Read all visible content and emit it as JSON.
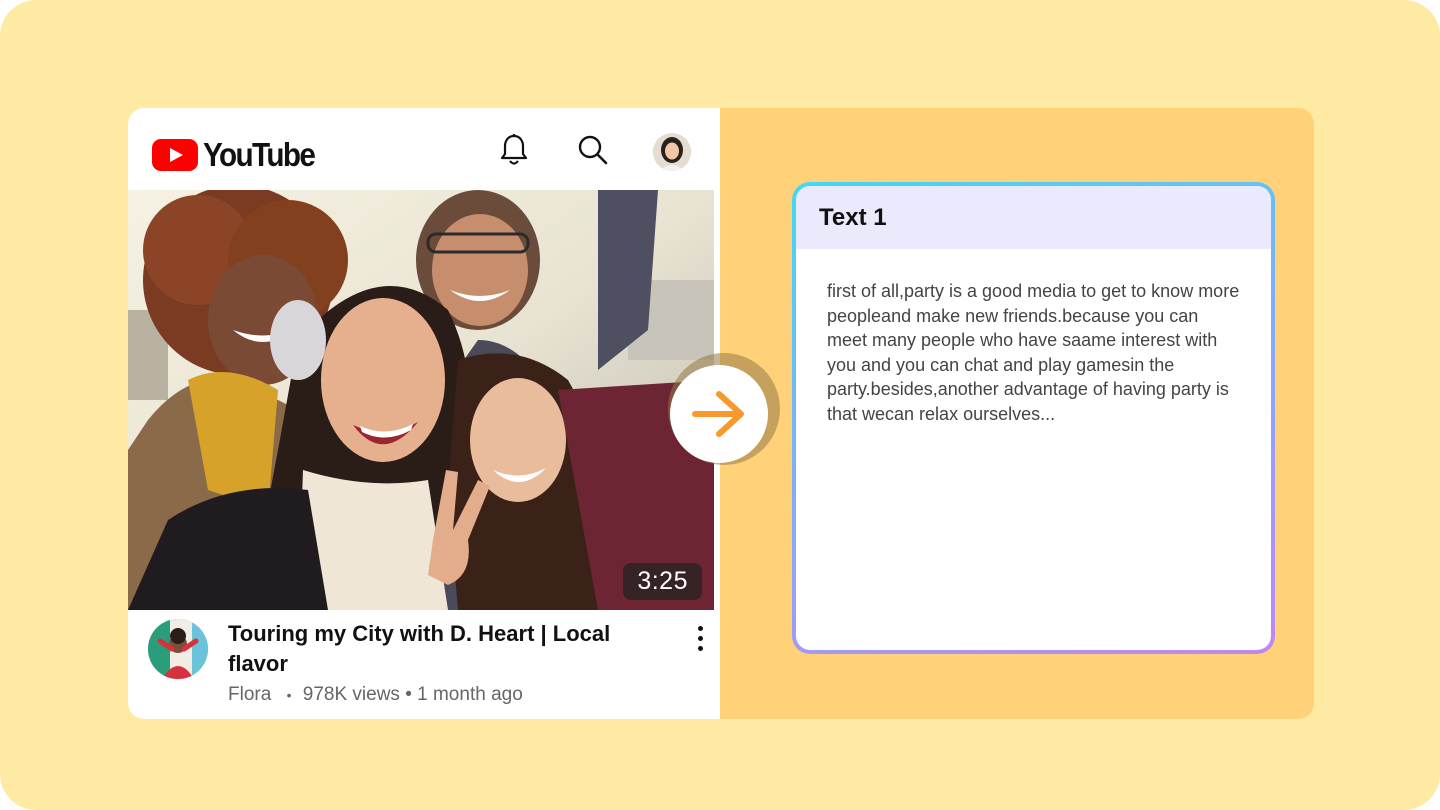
{
  "youtube": {
    "logo_text": "YouTube",
    "header_icons": [
      "bell-icon",
      "search-icon",
      "avatar"
    ],
    "video": {
      "duration": "3:25",
      "title": "Touring my City with D. Heart  | Local flavor",
      "channel": "Flora",
      "separator": "•",
      "views_age": "978K views • 1 month ago"
    }
  },
  "text_card": {
    "heading": "Text 1",
    "body": "first of all,party is a good media to get to know more peopleand make new friends.because you can meet many people who have saame interest with you and you can chat and play gamesin the party.besides,another advantage of having party is that wecan relax ourselves..."
  },
  "colors": {
    "background": "#ffeaa3",
    "panel": "#ffd27a",
    "youtube_red": "#ff0000",
    "arrow": "#f7992f",
    "card_header": "#ebeafd"
  }
}
